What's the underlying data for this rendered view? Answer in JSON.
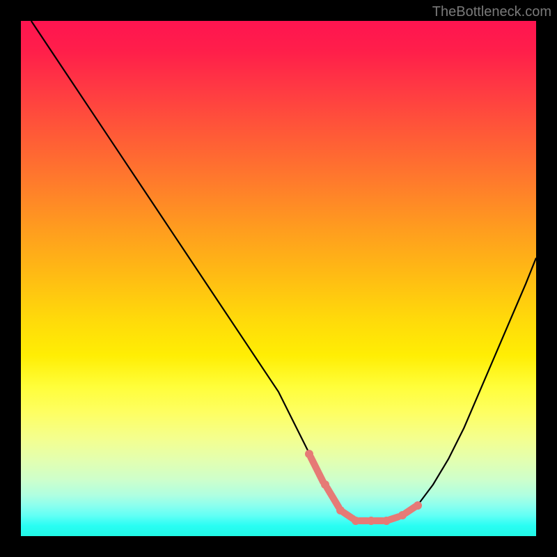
{
  "watermark": "TheBottleneck.com",
  "chart_data": {
    "type": "line",
    "title": "",
    "xlabel": "",
    "ylabel": "",
    "xlim": [
      0,
      100
    ],
    "ylim": [
      0,
      100
    ],
    "series": [
      {
        "name": "bottleneck-curve",
        "x": [
          2,
          8,
          14,
          20,
          26,
          32,
          38,
          44,
          50,
          53,
          56,
          59,
          62,
          65,
          68,
          71,
          74,
          77,
          80,
          83,
          86,
          89,
          92,
          95,
          98,
          100
        ],
        "y": [
          100,
          91,
          82,
          73,
          64,
          55,
          46,
          37,
          28,
          22,
          16,
          10,
          5,
          3,
          3,
          3,
          4,
          6,
          10,
          15,
          21,
          28,
          35,
          42,
          49,
          54
        ]
      }
    ],
    "highlighted_region": {
      "x": [
        56,
        59,
        62,
        65,
        68,
        71,
        74,
        77
      ],
      "y": [
        16,
        10,
        5,
        3,
        3,
        3,
        4,
        6
      ]
    },
    "background_gradient": {
      "top": "#ff1450",
      "middle": "#ffee04",
      "bottom": "#22f8e7"
    }
  }
}
